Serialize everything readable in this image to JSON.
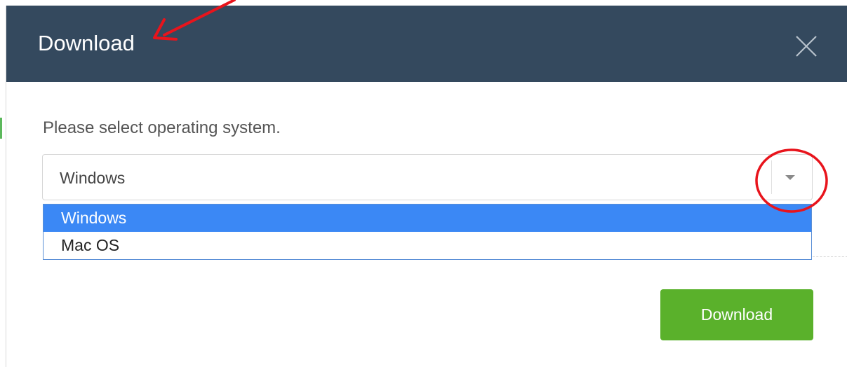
{
  "dialog": {
    "title": "Download",
    "prompt": "Please select operating system.",
    "close_icon": "close-icon"
  },
  "os_select": {
    "value": "Windows",
    "arrow_icon": "caret-down-icon",
    "options": [
      {
        "label": "Windows",
        "selected": true
      },
      {
        "label": "Mac OS",
        "selected": false
      }
    ]
  },
  "actions": {
    "download_label": "Download",
    "download_color": "#5ab12b"
  },
  "colors": {
    "header_bg": "#34495e",
    "selected_option_bg": "#3b88f5",
    "annotation": "#e8141c"
  },
  "annotations": {
    "arrow_target": "dialog-title",
    "circle_target": "select-arrow"
  }
}
